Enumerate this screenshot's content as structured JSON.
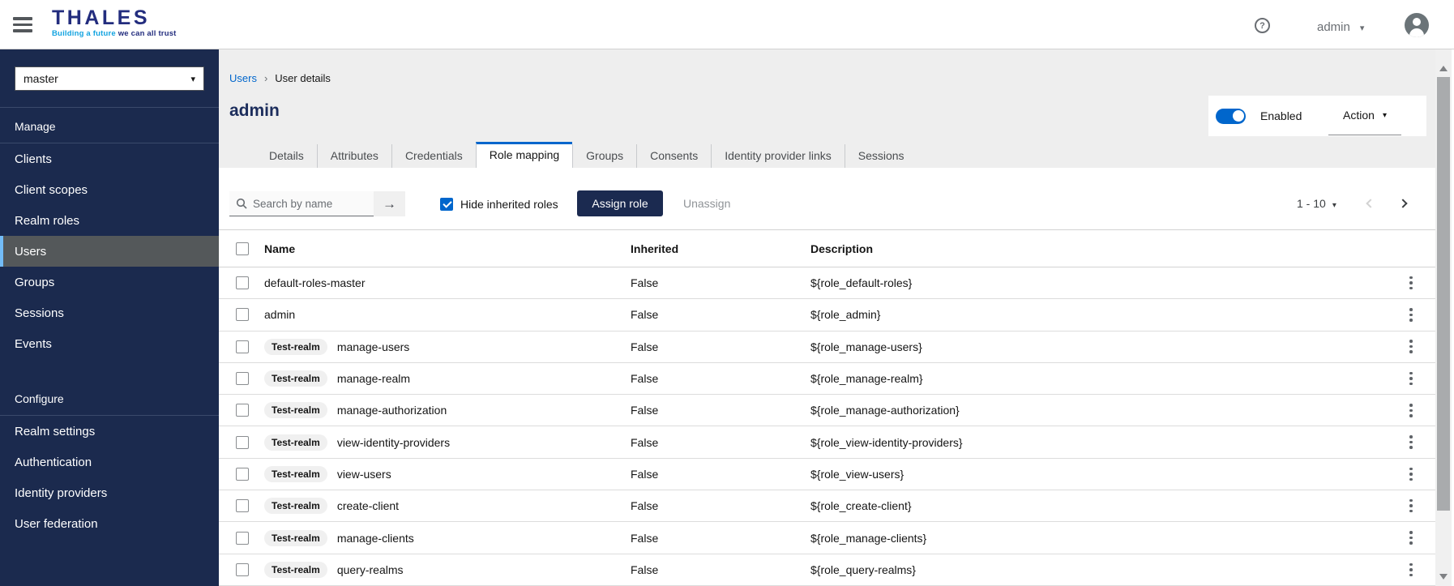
{
  "colors": {
    "brand_navy": "#1b2a4e",
    "logo_blue": "#232d7e",
    "tagline_cyan": "#12a3e0",
    "accent_blue": "#0066cc",
    "active_nav_bg": "#54585a",
    "active_nav_bar": "#73bcf7",
    "assign_button_bg": "#1b2a50"
  },
  "icons": {
    "help_glyph": "?",
    "caret_glyph": "▾",
    "search_submit_glyph": "→",
    "breadcrumb_separator": "›"
  },
  "header": {
    "brand": "THALES",
    "tagline_1": "Building a future",
    "tagline_2": " we can all trust",
    "user_menu_label": "admin"
  },
  "sidebar": {
    "realm_selector_value": "master",
    "sections": [
      {
        "label": "Manage",
        "items": [
          {
            "label": "Clients",
            "active": false
          },
          {
            "label": "Client scopes",
            "active": false
          },
          {
            "label": "Realm roles",
            "active": false
          },
          {
            "label": "Users",
            "active": true
          },
          {
            "label": "Groups",
            "active": false
          },
          {
            "label": "Sessions",
            "active": false
          },
          {
            "label": "Events",
            "active": false
          }
        ]
      },
      {
        "label": "Configure",
        "items": [
          {
            "label": "Realm settings",
            "active": false
          },
          {
            "label": "Authentication",
            "active": false
          },
          {
            "label": "Identity providers",
            "active": false
          },
          {
            "label": "User federation",
            "active": false
          }
        ]
      }
    ]
  },
  "main": {
    "breadcrumb": {
      "link": "Users",
      "current": "User details"
    },
    "page_title": "admin",
    "enabled_label": "Enabled",
    "enabled_state": true,
    "action_label": "Action",
    "tabs": [
      {
        "label": "Details",
        "active": false
      },
      {
        "label": "Attributes",
        "active": false
      },
      {
        "label": "Credentials",
        "active": false
      },
      {
        "label": "Role mapping",
        "active": true
      },
      {
        "label": "Groups",
        "active": false
      },
      {
        "label": "Consents",
        "active": false
      },
      {
        "label": "Identity provider links",
        "active": false
      },
      {
        "label": "Sessions",
        "active": false
      }
    ],
    "toolbar": {
      "search_placeholder": "Search by name",
      "hide_inherited_label": "Hide inherited roles",
      "hide_inherited_checked": true,
      "assign_role_label": "Assign role",
      "unassign_label": "Unassign"
    },
    "pagination": {
      "range_label": "1 - 10"
    },
    "table": {
      "columns": [
        "Name",
        "Inherited",
        "Description"
      ],
      "rows": [
        {
          "badge": null,
          "name": "default-roles-master",
          "inherited": "False",
          "description": "${role_default-roles}"
        },
        {
          "badge": null,
          "name": "admin",
          "inherited": "False",
          "description": "${role_admin}"
        },
        {
          "badge": "Test-realm",
          "name": "manage-users",
          "inherited": "False",
          "description": "${role_manage-users}"
        },
        {
          "badge": "Test-realm",
          "name": "manage-realm",
          "inherited": "False",
          "description": "${role_manage-realm}"
        },
        {
          "badge": "Test-realm",
          "name": "manage-authorization",
          "inherited": "False",
          "description": "${role_manage-authorization}"
        },
        {
          "badge": "Test-realm",
          "name": "view-identity-providers",
          "inherited": "False",
          "description": "${role_view-identity-providers}"
        },
        {
          "badge": "Test-realm",
          "name": "view-users",
          "inherited": "False",
          "description": "${role_view-users}"
        },
        {
          "badge": "Test-realm",
          "name": "create-client",
          "inherited": "False",
          "description": "${role_create-client}"
        },
        {
          "badge": "Test-realm",
          "name": "manage-clients",
          "inherited": "False",
          "description": "${role_manage-clients}"
        },
        {
          "badge": "Test-realm",
          "name": "query-realms",
          "inherited": "False",
          "description": "${role_query-realms}"
        }
      ]
    }
  }
}
